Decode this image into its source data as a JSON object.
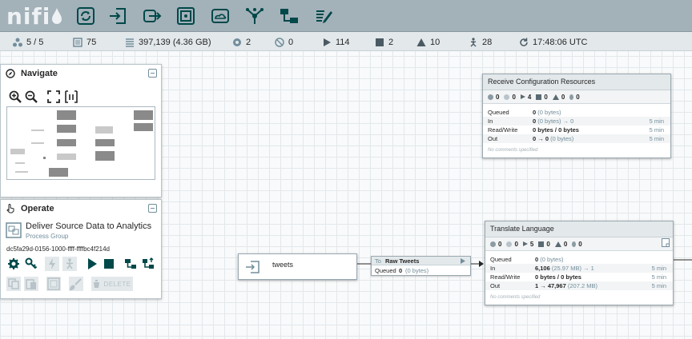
{
  "app": {
    "logo_text": "nifi"
  },
  "toolbar": {
    "items": [
      {
        "name": "process-group-icon"
      },
      {
        "name": "input-port-icon"
      },
      {
        "name": "output-port-icon"
      },
      {
        "name": "remote-process-group-icon"
      },
      {
        "name": "funnel-icon"
      },
      {
        "name": "template-icon"
      },
      {
        "name": "label-icon"
      },
      {
        "name": "processor-icon"
      }
    ]
  },
  "status": {
    "clustered_nodes": "5 / 5",
    "active_threads": "75",
    "queued": "397,139 (4.36 GB)",
    "transmitting": "2",
    "not_transmitting": "0",
    "running": "114",
    "stopped": "2",
    "invalid": "10",
    "disabled": "28",
    "refresh_time": "17:48:06 UTC"
  },
  "navigate": {
    "title": "Navigate"
  },
  "operate": {
    "title": "Operate",
    "selection_name": "Deliver Source Data to Analytics",
    "selection_type": "Process Group",
    "selection_id": "dc5fa29d-0156-1000-ffff-ffffbc4f214d",
    "delete_label": "DELETE"
  },
  "input_port": {
    "name": "tweets"
  },
  "connection": {
    "to_label": "To",
    "destination": "Raw Tweets",
    "queued_label": "Queued",
    "queued_value": "0",
    "queued_size": "(0 bytes)"
  },
  "processors": [
    {
      "title": "Receive Configuration Resources",
      "stats": {
        "transmitting": "0",
        "not_transmitting": "0",
        "running": "4",
        "stopped": "0",
        "invalid": "0",
        "disabled": "0"
      },
      "metrics": [
        {
          "label": "Queued",
          "value": "0",
          "detail": "(0 bytes)",
          "time": ""
        },
        {
          "label": "In",
          "value": "0",
          "detail": "(0 bytes) → 0",
          "time": "5 min"
        },
        {
          "label": "Read/Write",
          "value": "0 bytes / 0 bytes",
          "detail": "",
          "time": "5 min"
        },
        {
          "label": "Out",
          "value": "0 → 0",
          "detail": "(0 bytes)",
          "time": "5 min"
        }
      ],
      "comment": "No comments specified"
    },
    {
      "title": "Translate Language",
      "stats": {
        "transmitting": "0",
        "not_transmitting": "0",
        "running": "5",
        "stopped": "0",
        "invalid": "0",
        "disabled": "0"
      },
      "metrics": [
        {
          "label": "Queued",
          "value": "0",
          "detail": "(0 bytes)",
          "time": ""
        },
        {
          "label": "In",
          "value": "6,106",
          "detail": "(25.97 MB) → 1",
          "time": "5 min"
        },
        {
          "label": "Read/Write",
          "value": "0 bytes / 0 bytes",
          "detail": "",
          "time": "5 min"
        },
        {
          "label": "Out",
          "value": "1 → 47,967",
          "detail": "(207.2 MB)",
          "time": "5 min"
        }
      ],
      "comment": "No comments specified"
    }
  ],
  "colors": {
    "header_bg": "#a3b1b9",
    "toolbar_icon": "#004849",
    "accent": "#728e9b"
  }
}
